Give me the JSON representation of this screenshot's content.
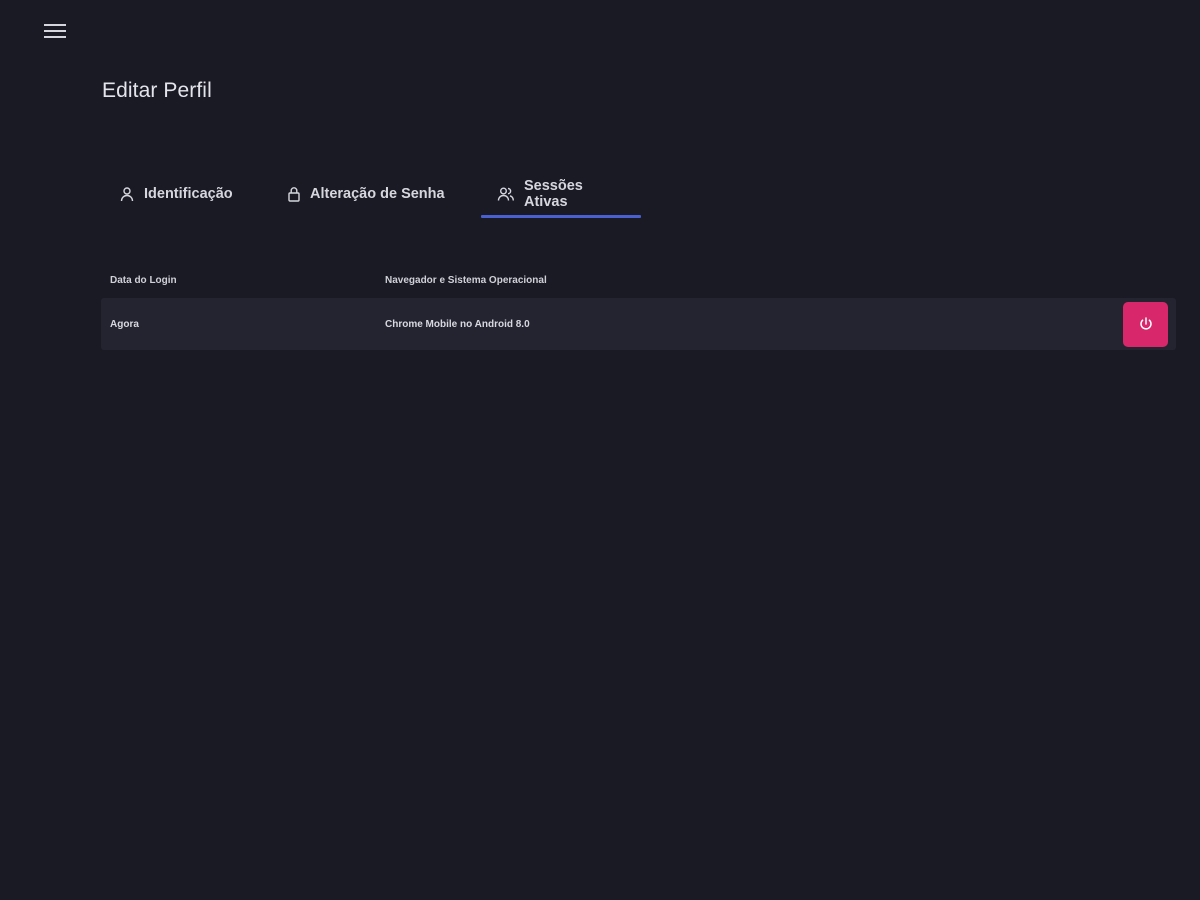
{
  "header": {
    "menu_icon": "hamburger-menu-icon",
    "title": "Editar Perfil"
  },
  "tabs": [
    {
      "label": "Identificação",
      "icon": "user-icon",
      "active": false
    },
    {
      "label": "Alteração de Senha",
      "icon": "lock-icon",
      "active": false
    },
    {
      "label": "Sessões Ativas",
      "icon": "users-icon",
      "active": true
    }
  ],
  "sessions_table": {
    "columns": [
      "Data do Login",
      "Navegador e Sistema Operacional"
    ],
    "rows": [
      {
        "date": "Agora",
        "browser": "Chrome Mobile no Android 8.0",
        "action_icon": "power-icon"
      }
    ]
  },
  "colors": {
    "background": "#191a24",
    "row_background": "#232430",
    "tab_indicator": "#4a5fd0",
    "danger_button": "#d8276a"
  }
}
